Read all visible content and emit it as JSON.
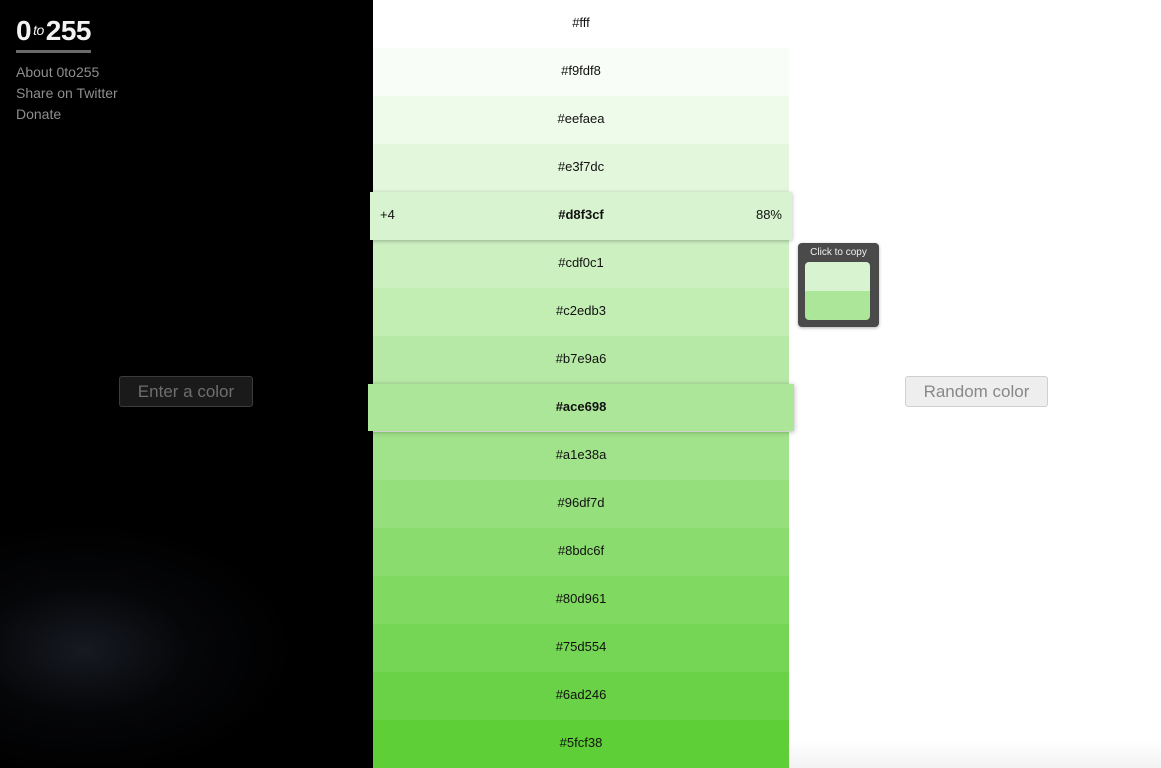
{
  "logo": {
    "main": "0",
    "to": "to",
    "number": "255"
  },
  "nav": [
    {
      "label": "About 0to255"
    },
    {
      "label": "Share on Twitter"
    },
    {
      "label": "Donate"
    }
  ],
  "enter_color": {
    "placeholder": "Enter a color",
    "value": ""
  },
  "random_button": {
    "label": "Random color"
  },
  "tooltip": {
    "text": "Click to copy",
    "preview_top_color": "#d8f3cf",
    "preview_bottom_color": "#ace698"
  },
  "hover_row": {
    "offset": "+4",
    "percent": "88%"
  },
  "selected_color": "#ace698",
  "hovered_color": "#d8f3cf",
  "shades": [
    {
      "hex": "#fff",
      "color": "#ffffff"
    },
    {
      "hex": "#f9fdf8",
      "color": "#f9fdf8"
    },
    {
      "hex": "#eefaea",
      "color": "#eefaea"
    },
    {
      "hex": "#e3f7dc",
      "color": "#e3f7dc"
    },
    {
      "hex": "#d8f3cf",
      "color": "#d8f3cf"
    },
    {
      "hex": "#cdf0c1",
      "color": "#cdf0c1"
    },
    {
      "hex": "#c2edb3",
      "color": "#c2edb3"
    },
    {
      "hex": "#b7e9a6",
      "color": "#b7e9a6"
    },
    {
      "hex": "#ace698",
      "color": "#ace698"
    },
    {
      "hex": "#a1e38a",
      "color": "#a1e38a"
    },
    {
      "hex": "#96df7d",
      "color": "#96df7d"
    },
    {
      "hex": "#8bdc6f",
      "color": "#8bdc6f"
    },
    {
      "hex": "#80d961",
      "color": "#80d961"
    },
    {
      "hex": "#75d554",
      "color": "#75d554"
    },
    {
      "hex": "#6ad246",
      "color": "#6ad246"
    },
    {
      "hex": "#5fcf38",
      "color": "#5fcf38"
    }
  ]
}
